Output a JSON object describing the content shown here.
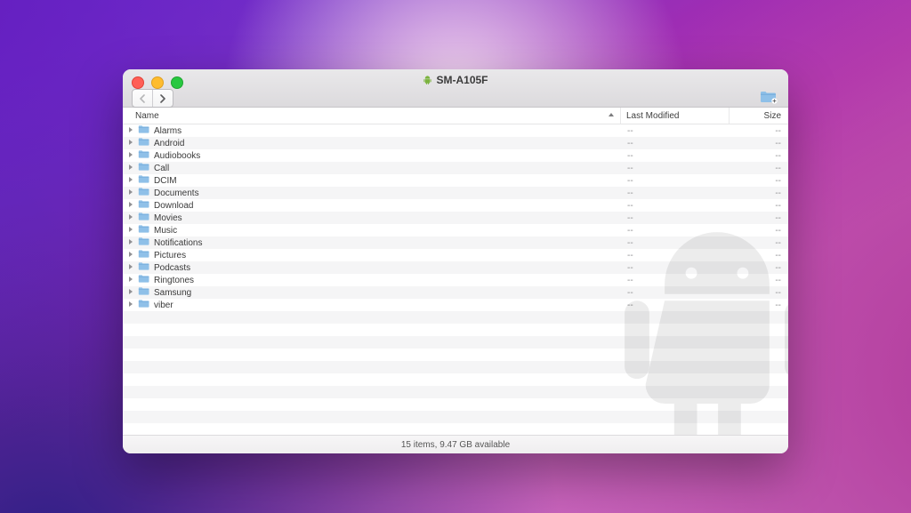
{
  "window": {
    "title": "SM-A105F"
  },
  "columns": {
    "name": "Name",
    "last_modified": "Last Modified",
    "size": "Size"
  },
  "items": [
    {
      "name": "Alarms",
      "modified": "--",
      "size": "--"
    },
    {
      "name": "Android",
      "modified": "--",
      "size": "--"
    },
    {
      "name": "Audiobooks",
      "modified": "--",
      "size": "--"
    },
    {
      "name": "Call",
      "modified": "--",
      "size": "--"
    },
    {
      "name": "DCIM",
      "modified": "--",
      "size": "--"
    },
    {
      "name": "Documents",
      "modified": "--",
      "size": "--"
    },
    {
      "name": "Download",
      "modified": "--",
      "size": "--"
    },
    {
      "name": "Movies",
      "modified": "--",
      "size": "--"
    },
    {
      "name": "Music",
      "modified": "--",
      "size": "--"
    },
    {
      "name": "Notifications",
      "modified": "--",
      "size": "--"
    },
    {
      "name": "Pictures",
      "modified": "--",
      "size": "--"
    },
    {
      "name": "Podcasts",
      "modified": "--",
      "size": "--"
    },
    {
      "name": "Ringtones",
      "modified": "--",
      "size": "--"
    },
    {
      "name": "Samsung",
      "modified": "--",
      "size": "--"
    },
    {
      "name": "viber",
      "modified": "--",
      "size": "--"
    }
  ],
  "status": "15 items, 9.47 GB available",
  "empty_rows_after": 11
}
